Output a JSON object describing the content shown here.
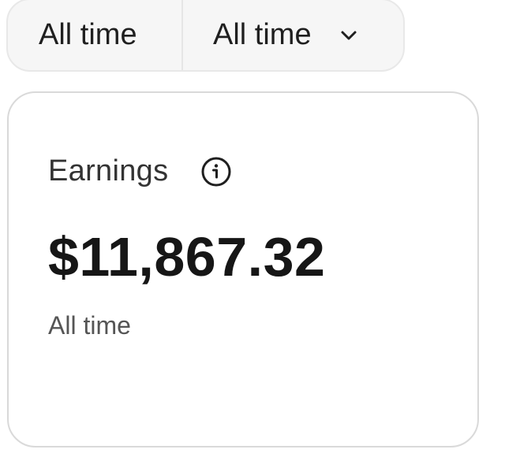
{
  "filters": {
    "first_label": "All time",
    "second_label": "All time",
    "dropdown_icon": "chevron-down-icon"
  },
  "earnings_card": {
    "title": "Earnings",
    "info_icon": "info-icon",
    "amount": "$11,867.32",
    "period": "All time"
  }
}
